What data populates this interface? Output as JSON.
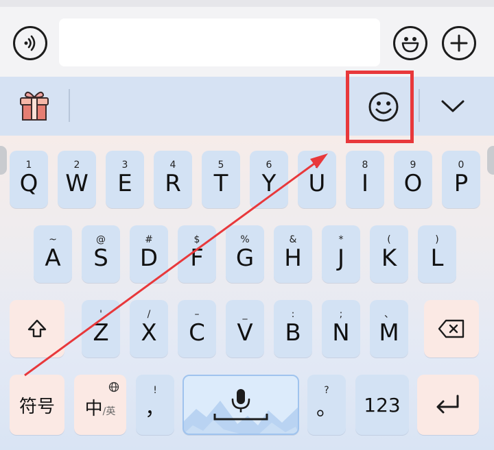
{
  "top_bar": {
    "voice_icon": "voice-wave-icon",
    "input_value": "",
    "input_placeholder": "",
    "emoji_icon": "smiley-grin-icon",
    "plus_icon": "plus-circle-icon"
  },
  "toolbar": {
    "gift_icon": "gift-box-icon",
    "emoji_icon": "smiley-icon",
    "collapse_icon": "chevron-down-icon"
  },
  "keyboard": {
    "row1": [
      {
        "sec": "1",
        "pri": "Q"
      },
      {
        "sec": "2",
        "pri": "W"
      },
      {
        "sec": "3",
        "pri": "E"
      },
      {
        "sec": "4",
        "pri": "R"
      },
      {
        "sec": "5",
        "pri": "T"
      },
      {
        "sec": "6",
        "pri": "Y"
      },
      {
        "sec": "7",
        "pri": "U"
      },
      {
        "sec": "8",
        "pri": "I"
      },
      {
        "sec": "9",
        "pri": "O"
      },
      {
        "sec": "0",
        "pri": "P"
      }
    ],
    "row2": [
      {
        "sec": "~",
        "pri": "A"
      },
      {
        "sec": "@",
        "pri": "S"
      },
      {
        "sec": "#",
        "pri": "D"
      },
      {
        "sec": "$",
        "pri": "F"
      },
      {
        "sec": "%",
        "pri": "G"
      },
      {
        "sec": "&",
        "pri": "H"
      },
      {
        "sec": "*",
        "pri": "J"
      },
      {
        "sec": "(",
        "pri": "K"
      },
      {
        "sec": ")",
        "pri": "L"
      }
    ],
    "row3": [
      {
        "sec": "'",
        "pri": "Z"
      },
      {
        "sec": "/",
        "pri": "X"
      },
      {
        "sec": "–",
        "pri": "C"
      },
      {
        "sec": "_",
        "pri": "V"
      },
      {
        "sec": ":",
        "pri": "B"
      },
      {
        "sec": ";",
        "pri": "N"
      },
      {
        "sec": "、",
        "pri": "M"
      }
    ],
    "shift_icon": "shift-arrow-icon",
    "backspace_icon": "backspace-icon",
    "symbols_label": "符号",
    "lang_main": "中",
    "lang_sub": "/英",
    "globe_icon": "globe-icon",
    "comma_sec": "!",
    "comma_pri": "，",
    "mic_icon": "microphone-icon",
    "period_sec": "?",
    "period_pri": "。",
    "numbers_label": "123",
    "enter_icon": "enter-return-icon"
  },
  "annotation": {
    "color": "#e8383b"
  }
}
